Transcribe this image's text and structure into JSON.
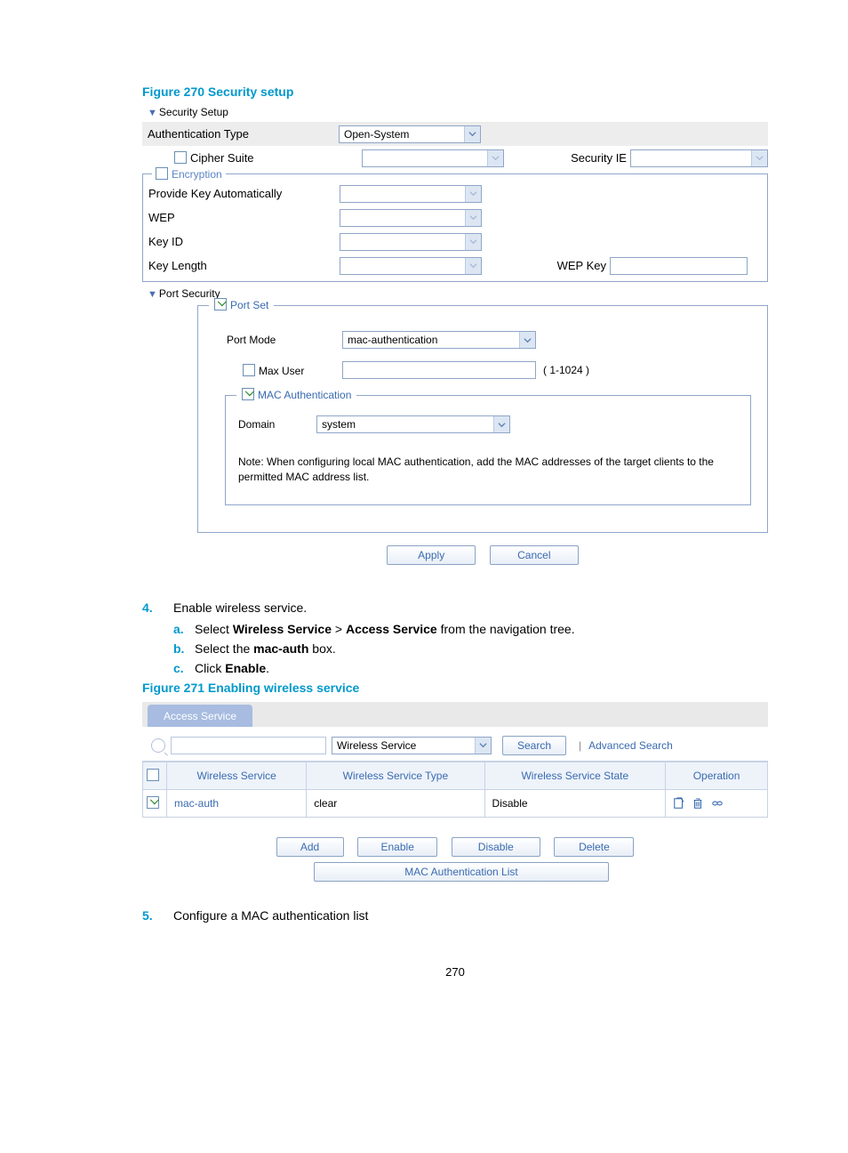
{
  "figure270": {
    "caption": "Figure 270 Security setup",
    "security_setup_header": "Security Setup",
    "auth_type_label": "Authentication Type",
    "auth_type_value": "Open-System",
    "cipher_suite_label": "Cipher Suite",
    "security_ie_label": "Security IE",
    "encryption_legend": "Encryption",
    "provide_key_label": "Provide Key Automatically",
    "wep_label": "WEP",
    "key_id_label": "Key ID",
    "key_length_label": "Key Length",
    "wep_key_label": "WEP Key",
    "port_security_header": "Port Security",
    "port_set_legend": "Port Set",
    "port_mode_label": "Port Mode",
    "port_mode_value": "mac-authentication",
    "max_user_label": "Max User",
    "max_user_range": "( 1-1024 )",
    "mac_auth_legend": "MAC Authentication",
    "domain_label": "Domain",
    "domain_value": "system",
    "mac_note": "Note: When configuring local MAC authentication, add the MAC addresses of the target clients to the permitted MAC address list.",
    "apply_btn": "Apply",
    "cancel_btn": "Cancel"
  },
  "steps": {
    "s4": {
      "num": "4.",
      "text": "Enable wireless service."
    },
    "s4a": {
      "let": "a.",
      "pre": "Select ",
      "b1": "Wireless Service",
      "mid": " > ",
      "b2": "Access Service",
      "post": " from the navigation tree."
    },
    "s4b": {
      "let": "b.",
      "pre": "Select the ",
      "b1": "mac-auth",
      "post": " box."
    },
    "s4c": {
      "let": "c.",
      "pre": "Click ",
      "b1": "Enable",
      "post": "."
    },
    "s5": {
      "num": "5.",
      "text": "Configure a MAC authentication list"
    }
  },
  "figure271": {
    "caption": "Figure 271 Enabling wireless service",
    "tab": "Access Service",
    "search_select": "Wireless Service",
    "search_btn": "Search",
    "adv_search": "Advanced Search",
    "th_ws": "Wireless Service",
    "th_type": "Wireless Service Type",
    "th_state": "Wireless Service State",
    "th_op": "Operation",
    "row": {
      "name": "mac-auth",
      "type": "clear",
      "state": "Disable"
    },
    "add_btn": "Add",
    "enable_btn": "Enable",
    "disable_btn": "Disable",
    "delete_btn": "Delete",
    "mac_auth_list_btn": "MAC Authentication List"
  },
  "page_number": "270"
}
